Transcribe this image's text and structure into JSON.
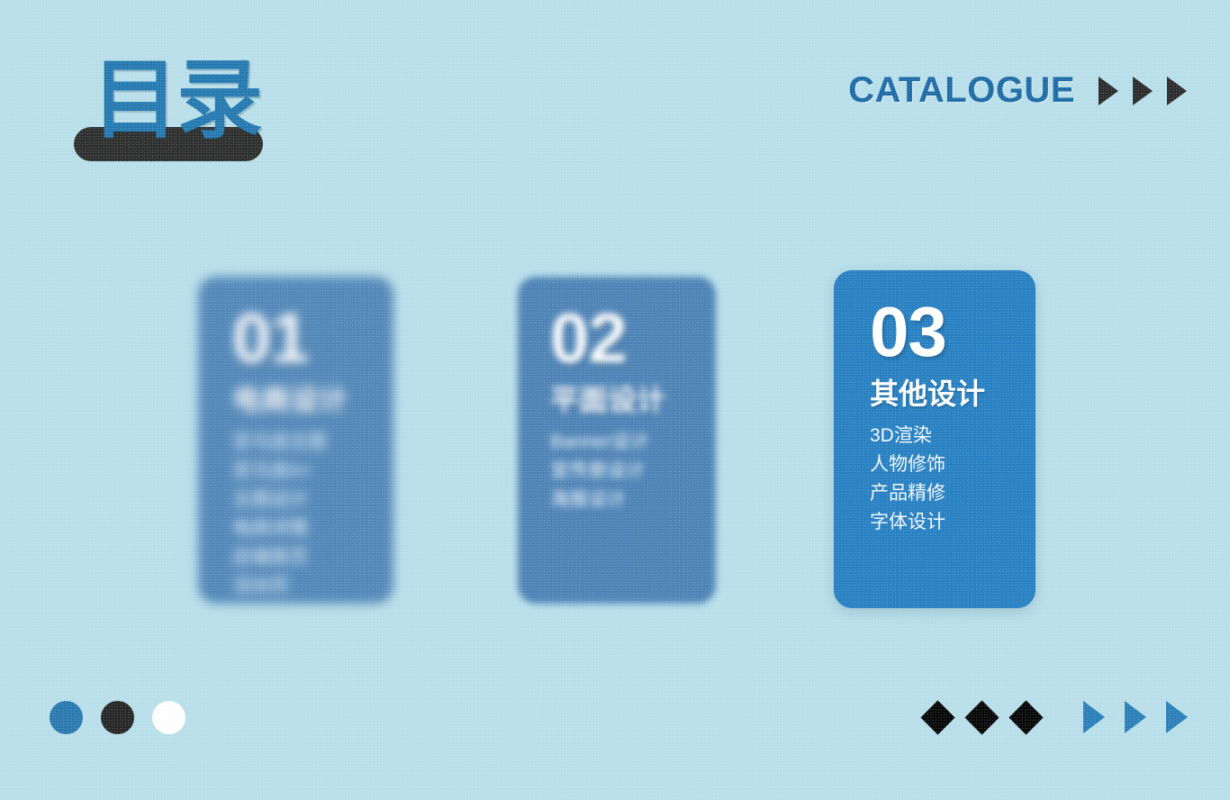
{
  "slide": {
    "background_color": "#b9dfea",
    "title_zh": "目录",
    "catalogue_label": "CATALOGUE",
    "header_arrow_icons": [
      "triangle-right-icon",
      "triangle-right-icon",
      "triangle-right-icon"
    ]
  },
  "colors": {
    "background": "#b9dfea",
    "title_blue": "#2479b0",
    "title_pill_dark": "#2e2e2e",
    "catalogue_blue": "#1d6aa6",
    "card_1": "#5287b8",
    "card_2": "#4d82b5",
    "card_3_accent": "#2780c2",
    "dot_blue": "#2a79ae",
    "dot_dark": "#262626",
    "dot_white": "#ffffff",
    "diamond_black": "#060606",
    "footer_triangle_blue": "#2b7fb8"
  },
  "cards": [
    {
      "number": "01",
      "heading": "电商设计",
      "items": [
        "亚马逊主图",
        "亚马逊A+",
        "主图设计",
        "电商详情",
        "店铺首页",
        "活动页"
      ]
    },
    {
      "number": "02",
      "heading": "平面设计",
      "items": [
        "Banner设计",
        "宣传册设计",
        "海报设计"
      ]
    },
    {
      "number": "03",
      "heading": "其他设计",
      "items": [
        "3D渲染",
        "人物修饰",
        "产品精修",
        "字体设计"
      ]
    }
  ],
  "footer": {
    "dot_icons": [
      "circle-filled-blue-icon",
      "circle-filled-dark-icon",
      "circle-filled-white-icon"
    ],
    "shape_icons": [
      "diamond-icon",
      "diamond-icon",
      "diamond-icon",
      "triangle-right-icon",
      "triangle-right-icon",
      "triangle-right-icon"
    ]
  }
}
